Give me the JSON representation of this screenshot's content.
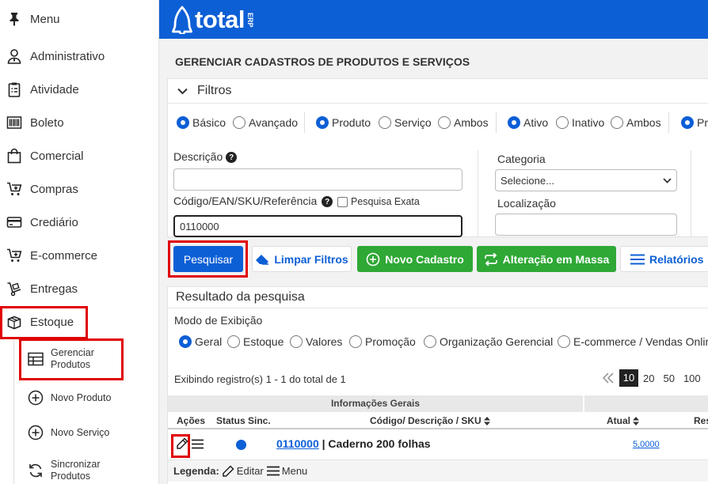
{
  "sidebar": {
    "menu_label": "Menu",
    "items": [
      {
        "label": "Administrativo"
      },
      {
        "label": "Atividade"
      },
      {
        "label": "Boleto"
      },
      {
        "label": "Comercial"
      },
      {
        "label": "Compras"
      },
      {
        "label": "Crediário"
      },
      {
        "label": "E-commerce"
      },
      {
        "label": "Entregas"
      },
      {
        "label": "Estoque"
      }
    ],
    "subitems": [
      {
        "label_1": "Gerenciar",
        "label_2": "Produtos"
      },
      {
        "label": "Novo Produto"
      },
      {
        "label": "Novo Serviço"
      },
      {
        "label_1": "Sincronizar",
        "label_2": "Produtos"
      }
    ]
  },
  "header": {
    "logo_text": "total",
    "logo_badge": "ERP"
  },
  "page": {
    "title": "GERENCIAR CADASTROS DE PRODUTOS E SERVIÇOS"
  },
  "filters": {
    "title": "Filtros",
    "mode": {
      "basic": "Básico",
      "advanced": "Avançado",
      "selected": "Básico"
    },
    "kind": {
      "product": "Produto",
      "service": "Serviço",
      "both": "Ambos",
      "selected": "Produto"
    },
    "status": {
      "active": "Ativo",
      "inactive": "Inativo",
      "both": "Ambos",
      "selected": "Ativo"
    },
    "extra": {
      "label": "Pro"
    },
    "descricao_label": "Descrição",
    "descricao_value": "",
    "codigo_label": "Código/EAN/SKU/Referência",
    "exact_label": "Pesquisa Exata",
    "codigo_value": "0110000",
    "categoria_label": "Categoria",
    "categoria_selected": "Selecione...",
    "localizacao_label": "Localização",
    "localizacao_value": ""
  },
  "actions": {
    "search": "Pesquisar",
    "clear": "Limpar Filtros",
    "new": "Novo Cadastro",
    "mass": "Alteração em Massa",
    "reports": "Relatórios"
  },
  "results": {
    "title": "Resultado da pesquisa",
    "display_label": "Modo de Exibição",
    "modes": [
      "Geral",
      "Estoque",
      "Valores",
      "Promoção",
      "Organização Gerencial",
      "E-commerce / Vendas Online"
    ],
    "selected_mode": "Geral",
    "count_text": "Exibindo registro(s) 1 - 1 do total de 1",
    "page_sizes": [
      "10",
      "20",
      "50",
      "100"
    ],
    "page_size_selected": "10",
    "group_header": "Informações Gerais",
    "columns": {
      "actions": "Ações",
      "sync": "Status Sinc.",
      "code": "Código/ Descrição / SKU",
      "current": "Atual",
      "reserved": "Res"
    },
    "rows": [
      {
        "code": "0110000",
        "description": "| Caderno 200 folhas",
        "current": "5,0000"
      }
    ],
    "legend": {
      "label": "Legenda:",
      "edit": "Editar",
      "menu": "Menu"
    }
  },
  "colors": {
    "primary": "#0d5fd6",
    "success": "#2fa836",
    "highlight": "#e00000"
  }
}
